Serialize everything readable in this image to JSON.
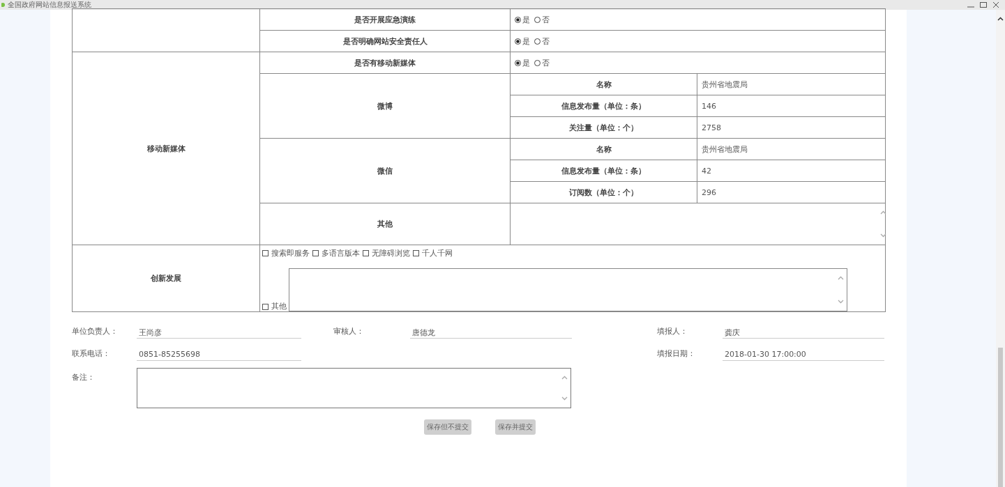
{
  "window": {
    "title": "全国政府网站信息报送系统"
  },
  "security_rows": [
    {
      "question": "是否开展应急演练",
      "options": [
        {
          "label": "是",
          "selected": true
        },
        {
          "label": "否",
          "selected": false
        }
      ]
    },
    {
      "question": "是否明确网站安全责任人",
      "options": [
        {
          "label": "是",
          "selected": true
        },
        {
          "label": "否",
          "selected": false
        }
      ]
    }
  ],
  "mobile_media": {
    "section": "移动新媒体",
    "question": {
      "question": "是否有移动新媒体",
      "options": [
        {
          "label": "是",
          "selected": true
        },
        {
          "label": "否",
          "selected": false
        }
      ]
    },
    "accounts": [
      {
        "platform": "微博",
        "fields": [
          {
            "label": "名称",
            "value": "贵州省地震局"
          },
          {
            "label": "信息发布量（单位：条）",
            "value": "146"
          },
          {
            "label": "关注量（单位：个）",
            "value": "2758"
          }
        ]
      },
      {
        "platform": "微信",
        "fields": [
          {
            "label": "名称",
            "value": "贵州省地震局"
          },
          {
            "label": "信息发布量（单位：条）",
            "value": "42"
          },
          {
            "label": "订阅数（单位：个）",
            "value": "296"
          }
        ]
      }
    ],
    "other_label": "其他"
  },
  "innovation": {
    "section": "创新发展",
    "options": [
      {
        "label": "搜索即服务",
        "checked": false
      },
      {
        "label": "多语言版本",
        "checked": false
      },
      {
        "label": "无障碍浏览",
        "checked": false
      },
      {
        "label": "千人千网",
        "checked": false
      }
    ],
    "other": {
      "label": "其他",
      "checked": false
    }
  },
  "footer": {
    "fields": [
      {
        "label": "单位负责人：",
        "value": "王尚彦"
      },
      {
        "label": "审核人：",
        "value": "唐德龙"
      },
      {
        "label": "填报人：",
        "value": "龚庆"
      },
      {
        "label": "联系电话：",
        "value": "0851-85255698"
      },
      {
        "label": "填报日期：",
        "value": "2018-01-30 17:00:00"
      }
    ],
    "remarks_label": "备注："
  },
  "buttons": [
    "保存但不提交",
    "保存并提交"
  ]
}
